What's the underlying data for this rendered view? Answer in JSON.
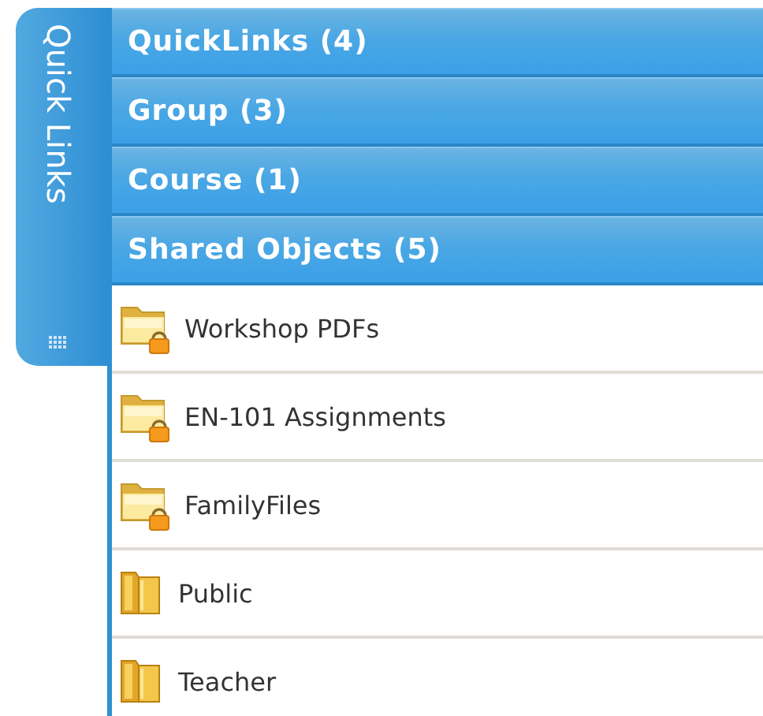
{
  "tab": {
    "label": "Quick Links"
  },
  "sections": [
    {
      "title": "QuickLinks (4)"
    },
    {
      "title": "Group (3)"
    },
    {
      "title": "Course (1)"
    },
    {
      "title": "Shared Objects (5)",
      "items": [
        {
          "label": "Workshop PDFs",
          "kind": "locked-folder"
        },
        {
          "label": "EN-101 Assignments",
          "kind": "locked-folder"
        },
        {
          "label": "FamilyFiles",
          "kind": "locked-folder"
        },
        {
          "label": "Public",
          "kind": "binder"
        },
        {
          "label": "Teacher",
          "kind": "binder"
        }
      ]
    }
  ]
}
